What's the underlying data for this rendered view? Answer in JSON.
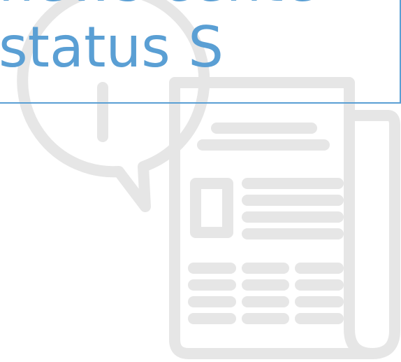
{
  "headline": {
    "line_top": "news cente",
    "line_bottom": "status S"
  },
  "icons": {
    "bubble": "speech-bubble-icon",
    "paper": "newspaper-icon"
  },
  "colors": {
    "accent": "#5a9fd4",
    "illustration": "#e6e6e6"
  }
}
